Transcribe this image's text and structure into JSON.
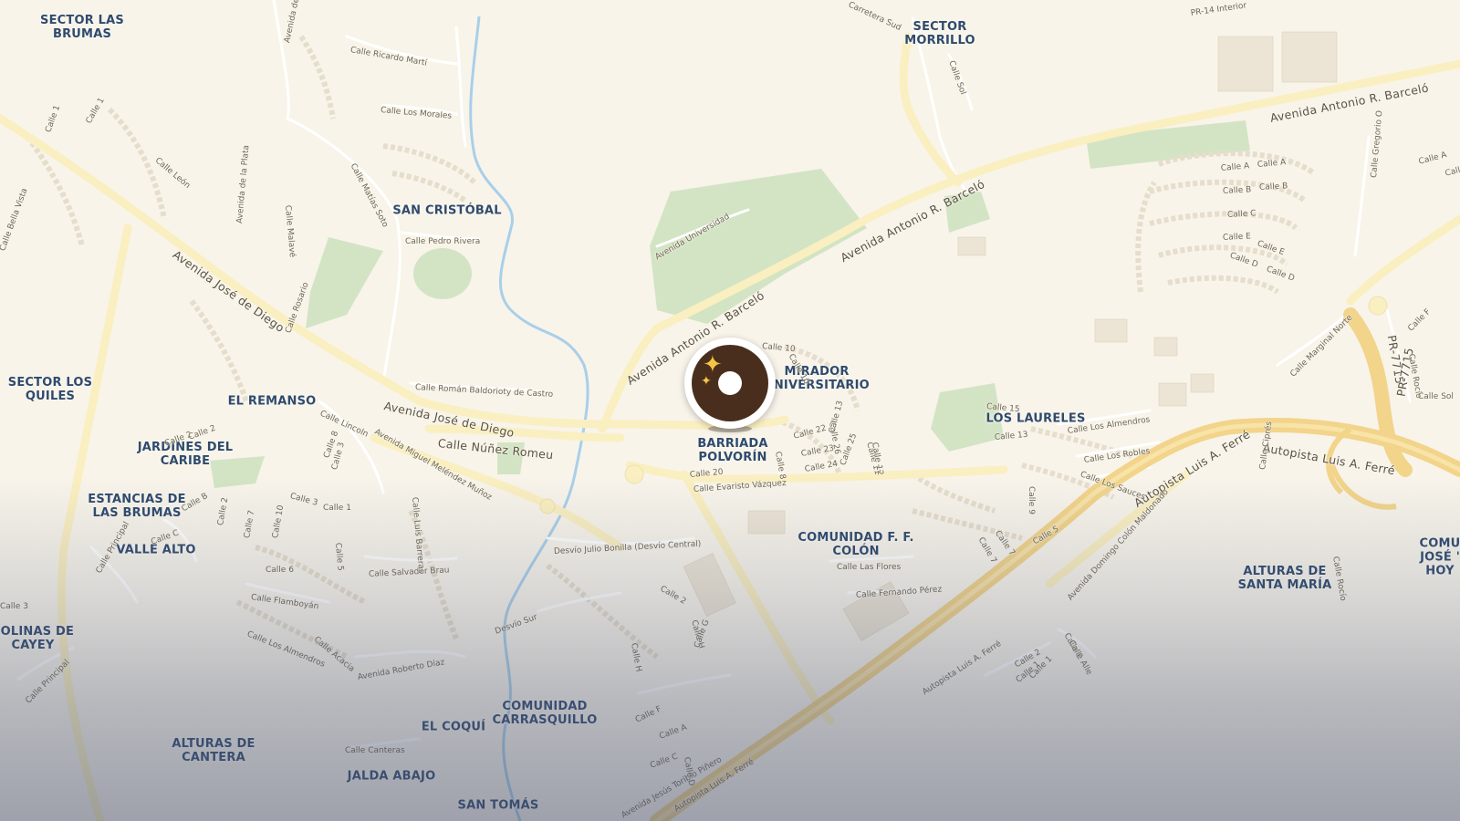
{
  "colors": {
    "background": "#f8f4ea",
    "park": "#cfe3c0",
    "motorway": "#f5d88c",
    "major_road": "#fbeeb8",
    "minor_road": "#ffffff",
    "building": "#e9e1d1",
    "river": "#a8cde8",
    "label": "#2f4a6e",
    "pin": "#4a2e1d",
    "pin_accent": "#f5c646"
  },
  "marker": {
    "icon": "sparkles-donut-icon"
  },
  "area_labels": [
    "SECTOR LAS\nBRUMAS",
    "SECTOR\nMORRILLO",
    "SAN CRISTÓBAL",
    "SECTOR LOS\nQUILES",
    "EL REMANSO",
    "JARDINES DEL\nCARIBE",
    "ESTANCIAS DE\nLAS BRUMAS",
    "VALLE ALTO",
    "COLINAS DE\nCAYEY",
    "ALTURAS DE\nCANTERA",
    "JALDA ABAJO",
    "EL COQUÍ",
    "COMUNIDAD\nCARRASQUILLO",
    "SAN TOMÁS",
    "MIRADOR\nUNIVERSITARIO",
    "BARRIADA\nPOLVORÍN",
    "LOS LAURELES",
    "COMUNIDAD F. F.\nCOLÓN",
    "ALTURAS DE\nSANTA MARÍA",
    "COMU\nJOSÉ '\nHOY"
  ],
  "road_labels": [
    "Avenida Antonio R. Barceló",
    "Avenida Antonio R. Barceló",
    "Avenida Antonio R. Barceló",
    "Avenida José de Diego",
    "Avenida José de Diego",
    "Calle Núñez Romeu",
    "Avenida Miguel Meléndez Muñoz",
    "Autopista Luis A. Ferré",
    "Autopista Luis A. Ferré",
    "Autopista Luis A. Ferré",
    "Autopista Luis A. Ferré",
    "Avenida Jesús Toribio Piñero",
    "Avenida Domingo Colón Maldonado",
    "PR-7715",
    "PR-7715",
    "PR-14 Interior",
    "Carretera Sud",
    "Calle Sol",
    "Calle Ricardo Martí",
    "Calle Los Morales",
    "Calle Matías Soto",
    "Calle Pedro Rivera",
    "Avenida de la Plata",
    "Avenida de la Plata",
    "Calle León",
    "Calle Bella Vista",
    "Calle Rosario",
    "Calle Malavé",
    "Calle Román Baldorioty de Castro",
    "Calle Lincoln",
    "Desvío Julio Bonilla (Desvío Central)",
    "Calle Salvador Brau",
    "Calle Flamboyán",
    "Calle Los Almendros",
    "Calle Acacia",
    "Avenida Roberto Díaz",
    "Desvío Sur",
    "Calle Canteras",
    "Calle Principal",
    "Calle Principal",
    "Calle Luis Barreras",
    "Avenida Universidad",
    "Calle Evaristo Vázquez",
    "Calle Las Flores",
    "Calle Fernando Pérez",
    "Calle Los Almendros",
    "Calle Los Robles",
    "Calle Los Sauces",
    "Calle Marginal Norte",
    "Calle Ciprés",
    "Calle Rocío",
    "Calle Rocío",
    "Calle Gregorio O",
    "Calle A",
    "Calle A",
    "Calle B",
    "Calle B",
    "Calle C",
    "Calle E",
    "Calle E",
    "Calle D",
    "Calle D",
    "Calle 15",
    "Calle 13",
    "Calle 10",
    "Calle 10",
    "Calle 20",
    "Calle 22",
    "Calle 23",
    "Calle 24",
    "Calle 25",
    "Calle 26",
    "Calle 11",
    "Calle 12",
    "Calle 13",
    "Calle 8",
    "Calle 7",
    "Calle 7",
    "Calle 5",
    "Calle 9",
    "Calle 2",
    "Calle H",
    "Calle H",
    "Calle G",
    "Calle F",
    "Calle A",
    "Calle C",
    "Calle D",
    "Calle E",
    "Calle 1",
    "Calle 2",
    "Calle 2",
    "Calle 3",
    "Calle 1",
    "Calle 1",
    "Calle 1",
    "Calle 3",
    "Calle 8",
    "Calle 7",
    "Calle 10",
    "Calle 6",
    "Calle 5",
    "Calle 2",
    "Calle B",
    "Calle C",
    "Calle F",
    "Calle Sol",
    "Calle D",
    "Calle A",
    "Calle Alle",
    "Calle 1",
    "Calle 2",
    "Calle 3",
    "Calle 1"
  ]
}
